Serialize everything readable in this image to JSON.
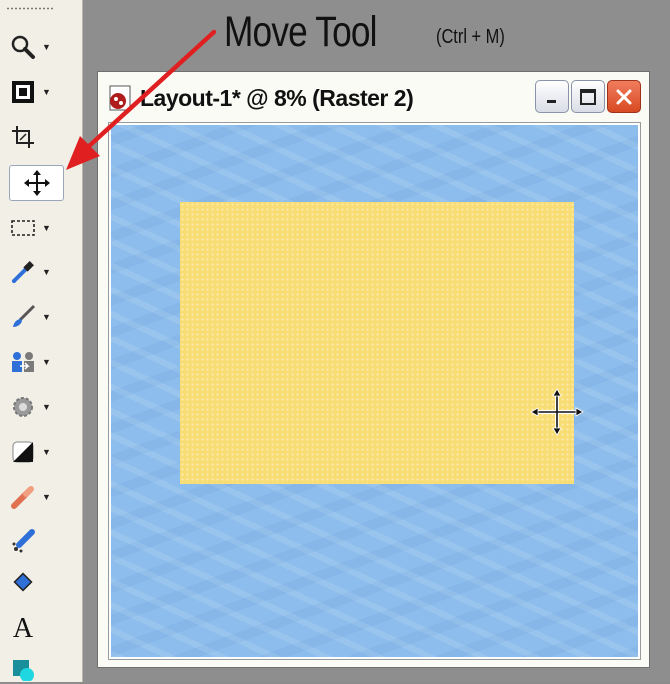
{
  "callout": {
    "title": "Move Tool",
    "shortcut": "(Ctrl + M)"
  },
  "document": {
    "title": "Layout-1* @   8% (Raster 2)"
  },
  "palette": {
    "tools": [
      {
        "name": "zoom-tool",
        "icon": "magnifier-icon",
        "dropdown": true
      },
      {
        "name": "view-tool",
        "icon": "frame-icon",
        "dropdown": true
      },
      {
        "name": "crop-tool",
        "icon": "crop-icon",
        "dropdown": false
      },
      {
        "name": "move-tool",
        "icon": "move-icon",
        "dropdown": false,
        "active": true
      },
      {
        "name": "selection-tool",
        "icon": "marquee-icon",
        "dropdown": true
      },
      {
        "name": "dropper-tool",
        "icon": "dropper-icon",
        "dropdown": true
      },
      {
        "name": "paint-brush-tool",
        "icon": "brush-icon",
        "dropdown": true
      },
      {
        "name": "clone-tool",
        "icon": "clone-icon",
        "dropdown": true
      },
      {
        "name": "scratch-remover-tool",
        "icon": "gear-icon",
        "dropdown": true
      },
      {
        "name": "dodge-tool",
        "icon": "contrast-icon",
        "dropdown": true
      },
      {
        "name": "eraser-tool",
        "icon": "eraser-icon",
        "dropdown": true
      },
      {
        "name": "picture-tube-tool",
        "icon": "tube-icon",
        "dropdown": false
      },
      {
        "name": "fill-tool",
        "icon": "bucket-icon",
        "dropdown": false
      },
      {
        "name": "text-tool",
        "icon": "text-icon",
        "glyph": "A",
        "dropdown": false
      },
      {
        "name": "preset-shape-tool",
        "icon": "shape-icon",
        "dropdown": false
      }
    ],
    "dropdown_glyph": "▼"
  },
  "colors": {
    "canvas": "#8dbdec",
    "layer": "#f7dd74",
    "arrow": "#e02020",
    "workspace": "#8e8e8e"
  }
}
